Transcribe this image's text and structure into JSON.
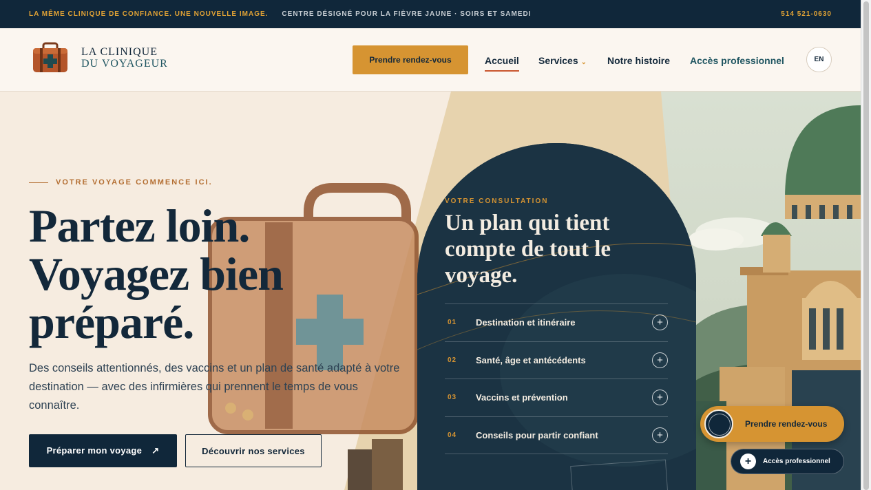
{
  "topbar": {
    "slogan": "LA MÊME CLINIQUE DE CONFIANCE. UNE NOUVELLE IMAGE.",
    "center": "CENTRE DÉSIGNÉ POUR LA FIÈVRE JAUNE · SOIRS ET SAMEDI",
    "phone": "514 521-0630"
  },
  "header": {
    "logo_line1": "LA CLINIQUE",
    "logo_line2": "DU VOYAGEUR",
    "logo_icon": "medical-suitcase-icon",
    "cta_label": "Prendre rendez-vous",
    "nav": {
      "home": "Accueil",
      "services": "Services",
      "story": "Notre histoire",
      "pro": "Accès professionnel"
    },
    "lang": "EN"
  },
  "hero": {
    "eyebrow": "VOTRE VOYAGE COMMENCE ICI.",
    "title_line1": "Partez loin.",
    "title_line2": "Voyagez bien",
    "title_line3": "préparé.",
    "description": "Des conseils attentionnés, des vaccins et un plan de santé adapté à votre destination — avec des infirmières qui prennent le temps de vous connaître.",
    "primary_button": "Préparer mon voyage",
    "primary_arrow": "↗",
    "secondary_button": "Découvrir nos services"
  },
  "consultation": {
    "eyebrow": "VOTRE CONSULTATION",
    "title_line1": "Un plan qui tient",
    "title_line2": "compte de tout le",
    "title_line3": "voyage.",
    "items": [
      {
        "num": "01",
        "label": "Destination et itinéraire",
        "icon": "plus-icon"
      },
      {
        "num": "02",
        "label": "Santé, âge et antécédents",
        "icon": "plus-icon"
      },
      {
        "num": "03",
        "label": "Vaccins et prévention",
        "icon": "plus-icon"
      },
      {
        "num": "04",
        "label": "Conseils pour partir confiant",
        "icon": "plus-icon"
      }
    ]
  },
  "floating": {
    "cta_label": "Prendre rendez-vous",
    "pro_label": "Accès professionnel"
  },
  "colors": {
    "navy": "#10273a",
    "gold": "#d69432",
    "cream": "#f8efe4",
    "teal": "#1f5561",
    "accent_red": "#c9552e"
  }
}
